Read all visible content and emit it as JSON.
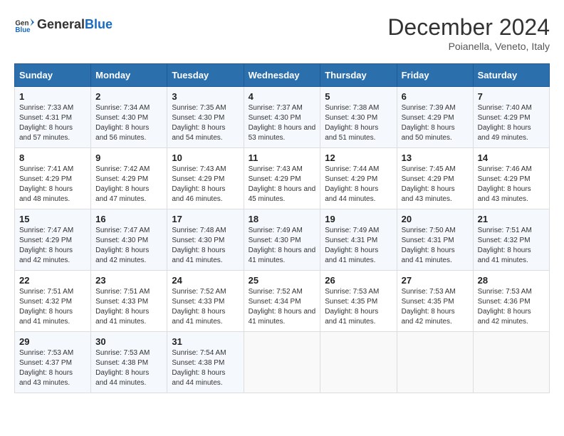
{
  "header": {
    "logo_general": "General",
    "logo_blue": "Blue",
    "month_title": "December 2024",
    "location": "Poianella, Veneto, Italy"
  },
  "weekdays": [
    "Sunday",
    "Monday",
    "Tuesday",
    "Wednesday",
    "Thursday",
    "Friday",
    "Saturday"
  ],
  "days": [
    {
      "date": "1",
      "sunrise": "7:33 AM",
      "sunset": "4:31 PM",
      "daylight": "8 hours and 57 minutes."
    },
    {
      "date": "2",
      "sunrise": "7:34 AM",
      "sunset": "4:30 PM",
      "daylight": "8 hours and 56 minutes."
    },
    {
      "date": "3",
      "sunrise": "7:35 AM",
      "sunset": "4:30 PM",
      "daylight": "8 hours and 54 minutes."
    },
    {
      "date": "4",
      "sunrise": "7:37 AM",
      "sunset": "4:30 PM",
      "daylight": "8 hours and 53 minutes."
    },
    {
      "date": "5",
      "sunrise": "7:38 AM",
      "sunset": "4:30 PM",
      "daylight": "8 hours and 51 minutes."
    },
    {
      "date": "6",
      "sunrise": "7:39 AM",
      "sunset": "4:29 PM",
      "daylight": "8 hours and 50 minutes."
    },
    {
      "date": "7",
      "sunrise": "7:40 AM",
      "sunset": "4:29 PM",
      "daylight": "8 hours and 49 minutes."
    },
    {
      "date": "8",
      "sunrise": "7:41 AM",
      "sunset": "4:29 PM",
      "daylight": "8 hours and 48 minutes."
    },
    {
      "date": "9",
      "sunrise": "7:42 AM",
      "sunset": "4:29 PM",
      "daylight": "8 hours and 47 minutes."
    },
    {
      "date": "10",
      "sunrise": "7:43 AM",
      "sunset": "4:29 PM",
      "daylight": "8 hours and 46 minutes."
    },
    {
      "date": "11",
      "sunrise": "7:43 AM",
      "sunset": "4:29 PM",
      "daylight": "8 hours and 45 minutes."
    },
    {
      "date": "12",
      "sunrise": "7:44 AM",
      "sunset": "4:29 PM",
      "daylight": "8 hours and 44 minutes."
    },
    {
      "date": "13",
      "sunrise": "7:45 AM",
      "sunset": "4:29 PM",
      "daylight": "8 hours and 43 minutes."
    },
    {
      "date": "14",
      "sunrise": "7:46 AM",
      "sunset": "4:29 PM",
      "daylight": "8 hours and 43 minutes."
    },
    {
      "date": "15",
      "sunrise": "7:47 AM",
      "sunset": "4:29 PM",
      "daylight": "8 hours and 42 minutes."
    },
    {
      "date": "16",
      "sunrise": "7:47 AM",
      "sunset": "4:30 PM",
      "daylight": "8 hours and 42 minutes."
    },
    {
      "date": "17",
      "sunrise": "7:48 AM",
      "sunset": "4:30 PM",
      "daylight": "8 hours and 41 minutes."
    },
    {
      "date": "18",
      "sunrise": "7:49 AM",
      "sunset": "4:30 PM",
      "daylight": "8 hours and 41 minutes."
    },
    {
      "date": "19",
      "sunrise": "7:49 AM",
      "sunset": "4:31 PM",
      "daylight": "8 hours and 41 minutes."
    },
    {
      "date": "20",
      "sunrise": "7:50 AM",
      "sunset": "4:31 PM",
      "daylight": "8 hours and 41 minutes."
    },
    {
      "date": "21",
      "sunrise": "7:51 AM",
      "sunset": "4:32 PM",
      "daylight": "8 hours and 41 minutes."
    },
    {
      "date": "22",
      "sunrise": "7:51 AM",
      "sunset": "4:32 PM",
      "daylight": "8 hours and 41 minutes."
    },
    {
      "date": "23",
      "sunrise": "7:51 AM",
      "sunset": "4:33 PM",
      "daylight": "8 hours and 41 minutes."
    },
    {
      "date": "24",
      "sunrise": "7:52 AM",
      "sunset": "4:33 PM",
      "daylight": "8 hours and 41 minutes."
    },
    {
      "date": "25",
      "sunrise": "7:52 AM",
      "sunset": "4:34 PM",
      "daylight": "8 hours and 41 minutes."
    },
    {
      "date": "26",
      "sunrise": "7:53 AM",
      "sunset": "4:35 PM",
      "daylight": "8 hours and 41 minutes."
    },
    {
      "date": "27",
      "sunrise": "7:53 AM",
      "sunset": "4:35 PM",
      "daylight": "8 hours and 42 minutes."
    },
    {
      "date": "28",
      "sunrise": "7:53 AM",
      "sunset": "4:36 PM",
      "daylight": "8 hours and 42 minutes."
    },
    {
      "date": "29",
      "sunrise": "7:53 AM",
      "sunset": "4:37 PM",
      "daylight": "8 hours and 43 minutes."
    },
    {
      "date": "30",
      "sunrise": "7:53 AM",
      "sunset": "4:38 PM",
      "daylight": "8 hours and 44 minutes."
    },
    {
      "date": "31",
      "sunrise": "7:54 AM",
      "sunset": "4:38 PM",
      "daylight": "8 hours and 44 minutes."
    }
  ],
  "labels": {
    "sunrise": "Sunrise:",
    "sunset": "Sunset:",
    "daylight": "Daylight:"
  }
}
